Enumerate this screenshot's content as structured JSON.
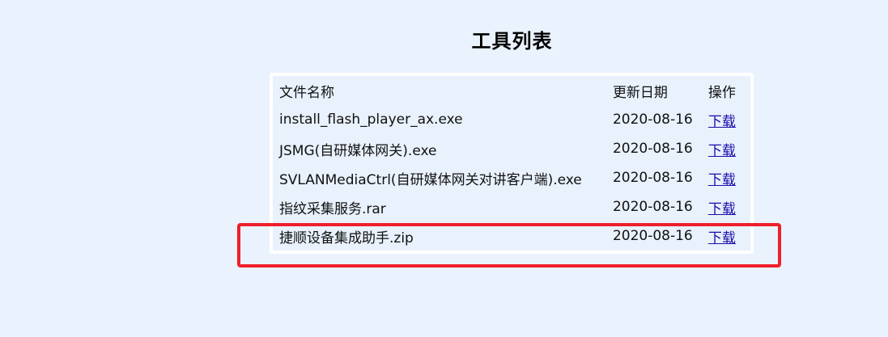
{
  "page": {
    "title": "工具列表"
  },
  "table": {
    "headers": {
      "name": "文件名称",
      "date": "更新日期",
      "action": "操作"
    },
    "rows": [
      {
        "name": "install_flash_player_ax.exe",
        "date": "2020-08-16",
        "action": "下载"
      },
      {
        "name": "JSMG(自研媒体网关).exe",
        "date": "2020-08-16",
        "action": "下载"
      },
      {
        "name": "SVLANMediaCtrl(自研媒体网关对讲客户端).exe",
        "date": "2020-08-16",
        "action": "下载"
      },
      {
        "name": "指纹采集服务.rar",
        "date": "2020-08-16",
        "action": "下载"
      },
      {
        "name": "捷顺设备集成助手.zip",
        "date": "2020-08-16",
        "action": "下载"
      }
    ]
  },
  "colors": {
    "background": "#eaf2fd",
    "link": "#1a0dab",
    "highlight": "#ee1f2a"
  }
}
